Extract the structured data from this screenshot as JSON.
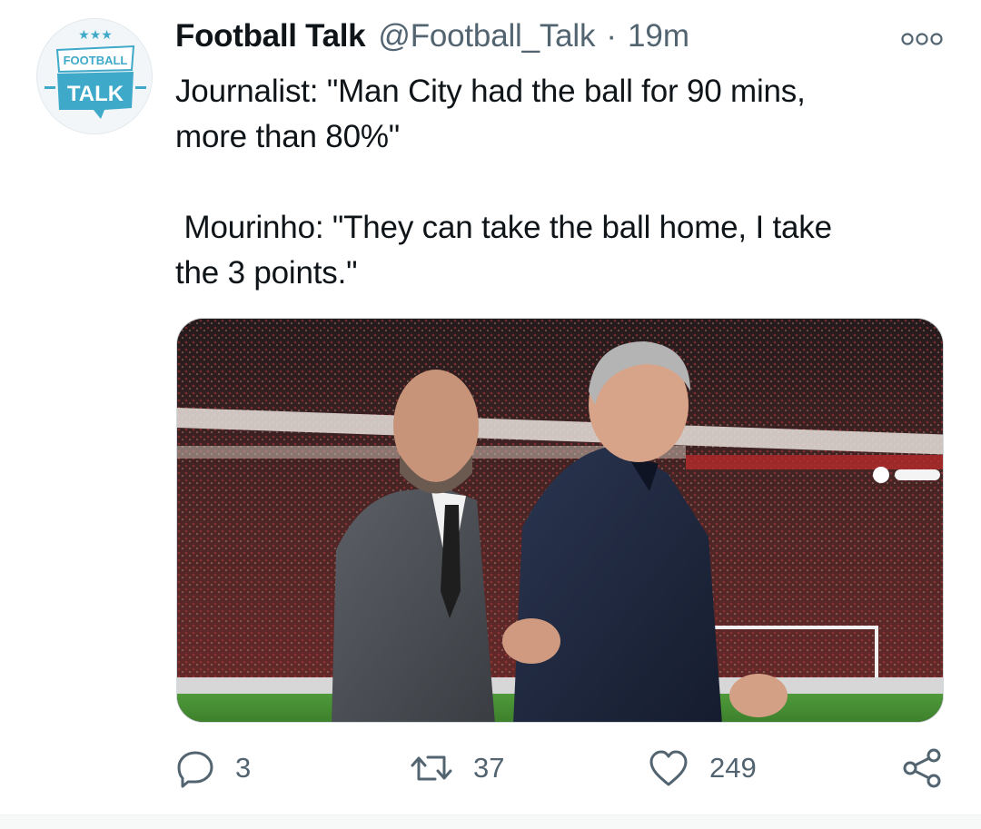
{
  "tweet": {
    "display_name": "Football Talk",
    "handle": "@Football_Talk",
    "separator": "·",
    "time": "19m",
    "avatar": {
      "logo_top": "FOOTBALL",
      "logo_bottom": "TALK",
      "accent": "#3fa9c9"
    },
    "text_lines": [
      "Journalist: \"Man City had the ball for 90 mins,",
      "more than 80%\"",
      " Mourinho: \"They can take the ball home, I take",
      "the 3 points.\""
    ],
    "actions": {
      "reply_count": "3",
      "retweet_count": "37",
      "like_count": "249"
    },
    "icons": {
      "more": "more-dots-icon",
      "reply": "reply-bubble-icon",
      "retweet": "retweet-arrows-icon",
      "like": "heart-icon",
      "share": "share-nodes-icon"
    },
    "colors": {
      "text": "#0f1419",
      "secondary": "#536471",
      "border": "#cfd9de"
    }
  }
}
